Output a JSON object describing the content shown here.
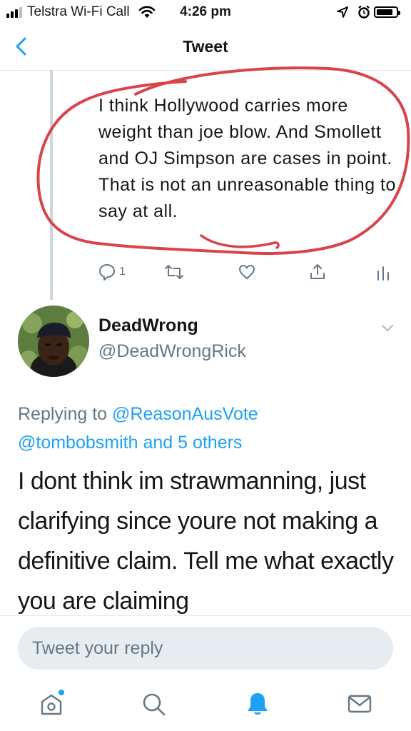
{
  "status_bar": {
    "carrier": "Telstra Wi-Fi Call",
    "time": "4:26 pm"
  },
  "nav": {
    "title": "Tweet"
  },
  "previous_tweet": {
    "text": "I think Hollywood carries more weight than joe blow. And Smollett and OJ Simpson are cases in point. That is not an unreasonable thing to say at all.",
    "reply_count": "1",
    "annotation_color": "#d9434a"
  },
  "reply": {
    "display_name": "DeadWrong",
    "handle": "@DeadWrongRick",
    "replying_prefix": "Replying to",
    "replying_to_primary": "@ReasonAusVote",
    "replying_to_secondary": "@tombobsmith and 5 others",
    "text": "I dont think im strawmanning, just clarifying since youre not making a definitive claim. Tell me what exactly you are claiming"
  },
  "composer": {
    "placeholder": "Tweet your reply"
  },
  "tabs": [
    "home-icon",
    "search-icon",
    "notifications-icon",
    "messages-icon"
  ],
  "colors": {
    "accent": "#1da1f2",
    "secondary_text": "#657786",
    "notification_dot": "#1da1f2"
  }
}
